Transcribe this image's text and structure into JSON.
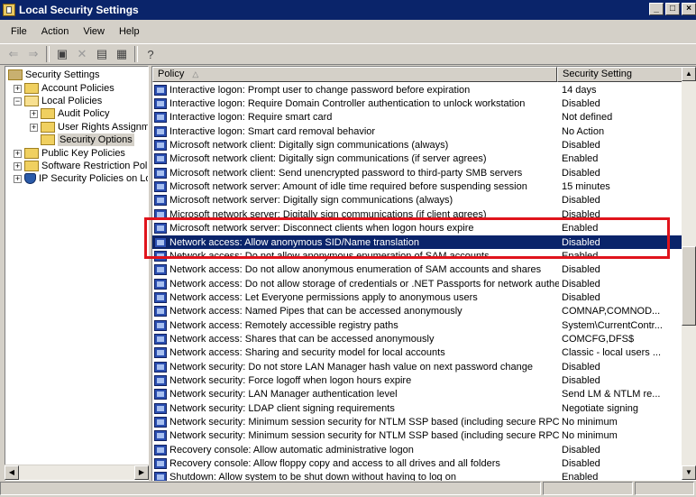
{
  "window": {
    "title": "Local Security Settings"
  },
  "menu": {
    "file": "File",
    "action": "Action",
    "view": "View",
    "help": "Help"
  },
  "toolbar": {
    "icons": [
      "back-arrow-icon",
      "forward-arrow-icon",
      "up-folder-icon",
      "delete-icon",
      "properties-icon",
      "export-list-icon",
      "help-icon"
    ]
  },
  "tree": {
    "root": "Security Settings",
    "account_policies": "Account Policies",
    "local_policies": "Local Policies",
    "audit_policy": "Audit Policy",
    "user_rights": "User Rights Assignmen",
    "security_options": "Security Options",
    "public_key": "Public Key Policies",
    "software_restriction": "Software Restriction Policie",
    "ip_security": "IP Security Policies on Loc"
  },
  "list": {
    "col_policy": "Policy",
    "col_sort_icon": "sort-ascending-icon",
    "col_setting": "Security Setting",
    "rows": [
      {
        "policy": "Interactive logon: Prompt user to change password before expiration",
        "setting": "14 days"
      },
      {
        "policy": "Interactive logon: Require Domain Controller authentication to unlock workstation",
        "setting": "Disabled"
      },
      {
        "policy": "Interactive logon: Require smart card",
        "setting": "Not defined"
      },
      {
        "policy": "Interactive logon: Smart card removal behavior",
        "setting": "No Action"
      },
      {
        "policy": "Microsoft network client: Digitally sign communications (always)",
        "setting": "Disabled"
      },
      {
        "policy": "Microsoft network client: Digitally sign communications (if server agrees)",
        "setting": "Enabled"
      },
      {
        "policy": "Microsoft network client: Send unencrypted password to third-party SMB servers",
        "setting": "Disabled"
      },
      {
        "policy": "Microsoft network server: Amount of idle time required before suspending session",
        "setting": "15 minutes"
      },
      {
        "policy": "Microsoft network server: Digitally sign communications (always)",
        "setting": "Disabled"
      },
      {
        "policy": "Microsoft network server: Digitally sign communications (if client agrees)",
        "setting": "Disabled"
      },
      {
        "policy": "Microsoft network server: Disconnect clients when logon hours expire",
        "setting": "Enabled"
      },
      {
        "policy": "Network access: Allow anonymous SID/Name translation",
        "setting": "Disabled"
      },
      {
        "policy": "Network access: Do not allow anonymous enumeration of SAM accounts",
        "setting": "Enabled"
      },
      {
        "policy": "Network access: Do not allow anonymous enumeration of SAM accounts and shares",
        "setting": "Disabled"
      },
      {
        "policy": "Network access: Do not allow storage of credentials or .NET Passports for network authentication",
        "setting": "Disabled"
      },
      {
        "policy": "Network access: Let Everyone permissions apply to anonymous users",
        "setting": "Disabled"
      },
      {
        "policy": "Network access: Named Pipes that can be accessed anonymously",
        "setting": "COMNAP,COMNOD..."
      },
      {
        "policy": "Network access: Remotely accessible registry paths",
        "setting": "System\\CurrentContr..."
      },
      {
        "policy": "Network access: Shares that can be accessed anonymously",
        "setting": "COMCFG,DFS$"
      },
      {
        "policy": "Network access: Sharing and security model for local accounts",
        "setting": "Classic - local users ..."
      },
      {
        "policy": "Network security: Do not store LAN Manager hash value on next password change",
        "setting": "Disabled"
      },
      {
        "policy": "Network security: Force logoff when logon hours expire",
        "setting": "Disabled"
      },
      {
        "policy": "Network security: LAN Manager authentication level",
        "setting": "Send LM & NTLM re..."
      },
      {
        "policy": "Network security: LDAP client signing requirements",
        "setting": "Negotiate signing"
      },
      {
        "policy": "Network security: Minimum session security for NTLM SSP based (including secure RPC) clients",
        "setting": "No minimum"
      },
      {
        "policy": "Network security: Minimum session security for NTLM SSP based (including secure RPC) servers",
        "setting": "No minimum"
      },
      {
        "policy": "Recovery console: Allow automatic administrative logon",
        "setting": "Disabled"
      },
      {
        "policy": "Recovery console: Allow floppy copy and access to all drives and all folders",
        "setting": "Disabled"
      },
      {
        "policy": "Shutdown: Allow system to be shut down without having to log on",
        "setting": "Enabled"
      }
    ]
  },
  "colors": {
    "selection": "#0a246a",
    "highlight_box": "#e0141c"
  }
}
